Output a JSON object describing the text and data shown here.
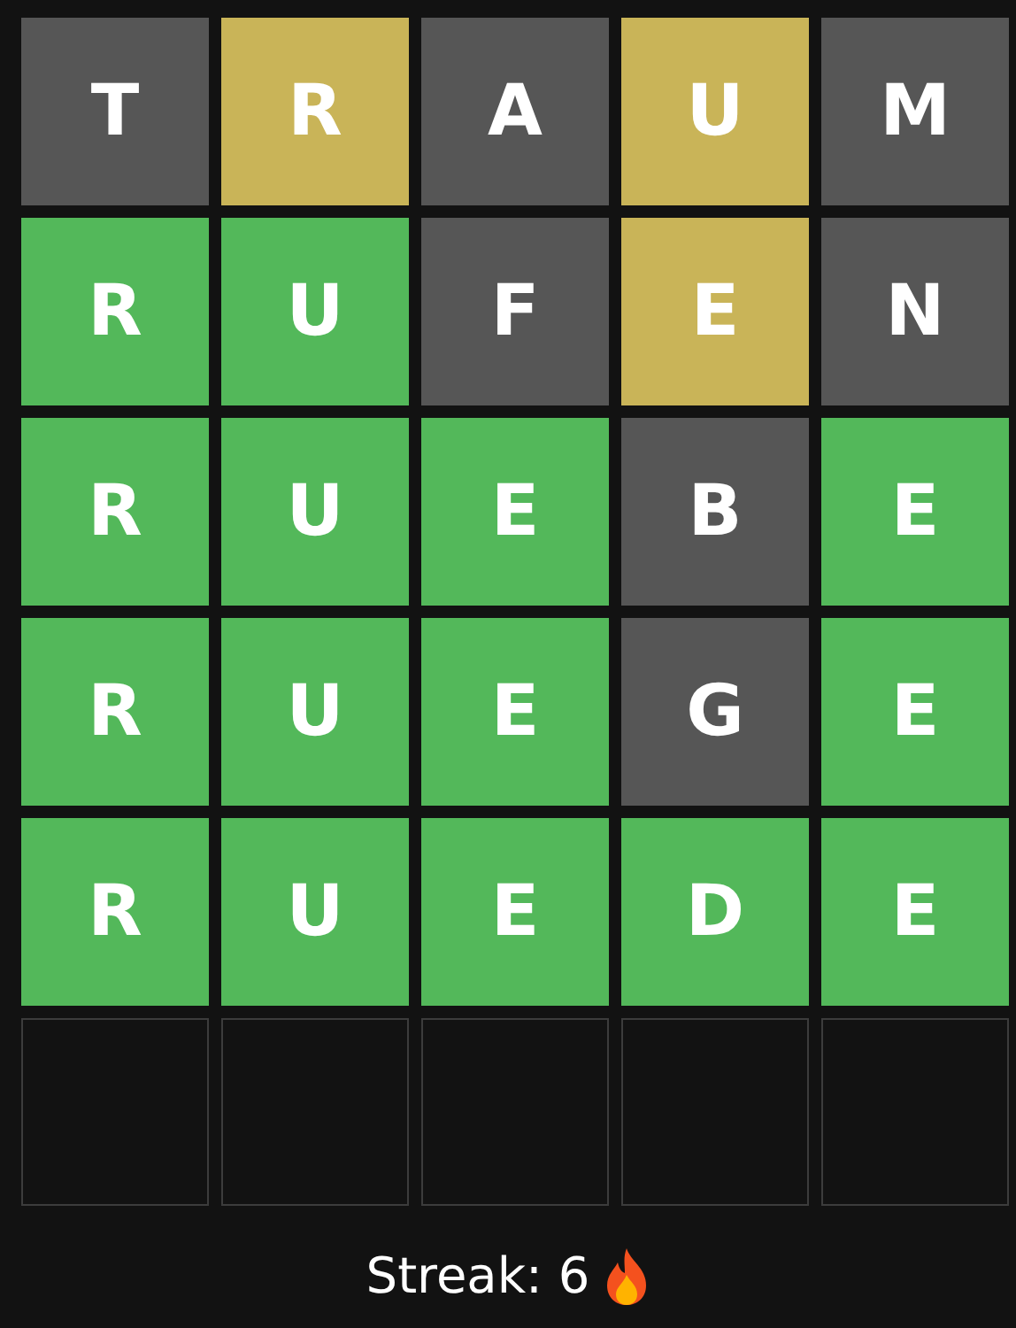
{
  "rows": [
    {
      "tiles": [
        {
          "letter": "T",
          "kind": "absent"
        },
        {
          "letter": "R",
          "kind": "present"
        },
        {
          "letter": "A",
          "kind": "absent"
        },
        {
          "letter": "U",
          "kind": "present"
        },
        {
          "letter": "M",
          "kind": "absent"
        }
      ]
    },
    {
      "tiles": [
        {
          "letter": "R",
          "kind": "correct"
        },
        {
          "letter": "U",
          "kind": "correct"
        },
        {
          "letter": "F",
          "kind": "absent"
        },
        {
          "letter": "E",
          "kind": "present"
        },
        {
          "letter": "N",
          "kind": "absent"
        }
      ]
    },
    {
      "tiles": [
        {
          "letter": "R",
          "kind": "correct"
        },
        {
          "letter": "U",
          "kind": "correct"
        },
        {
          "letter": "E",
          "kind": "correct"
        },
        {
          "letter": "B",
          "kind": "absent"
        },
        {
          "letter": "E",
          "kind": "correct"
        }
      ]
    },
    {
      "tiles": [
        {
          "letter": "R",
          "kind": "correct"
        },
        {
          "letter": "U",
          "kind": "correct"
        },
        {
          "letter": "E",
          "kind": "correct"
        },
        {
          "letter": "G",
          "kind": "absent"
        },
        {
          "letter": "E",
          "kind": "correct"
        }
      ]
    },
    {
      "tiles": [
        {
          "letter": "R",
          "kind": "correct"
        },
        {
          "letter": "U",
          "kind": "correct"
        },
        {
          "letter": "E",
          "kind": "correct"
        },
        {
          "letter": "D",
          "kind": "correct"
        },
        {
          "letter": "E",
          "kind": "correct"
        }
      ]
    },
    {
      "tiles": [
        {
          "kind": "empty"
        },
        {
          "kind": "empty"
        },
        {
          "kind": "empty"
        },
        {
          "kind": "empty"
        },
        {
          "kind": "empty"
        }
      ]
    }
  ],
  "streak": "Streak: 6"
}
